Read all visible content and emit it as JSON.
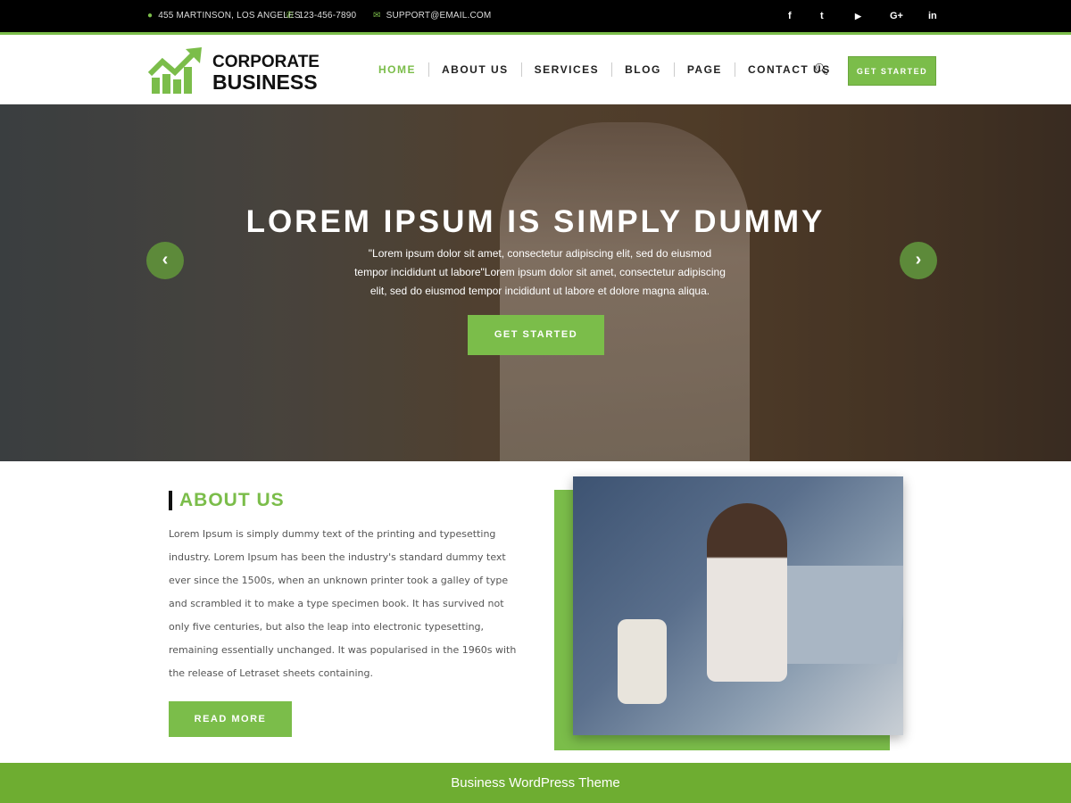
{
  "topbar": {
    "address": "455 MARTINSON, LOS ANGELES",
    "phone": "123-456-7890",
    "email": "SUPPORT@EMAIL.COM",
    "social": [
      {
        "icon": "facebook-icon",
        "glyph": "f"
      },
      {
        "icon": "twitter-icon",
        "glyph": "t"
      },
      {
        "icon": "youtube-icon",
        "glyph": "▶"
      },
      {
        "icon": "google-plus-icon",
        "glyph": "G+"
      },
      {
        "icon": "linkedin-icon",
        "glyph": "in"
      }
    ]
  },
  "header": {
    "logo_line1": "CORPORATE",
    "logo_line2": "BUSINESS",
    "nav": [
      "HOME",
      "ABOUT US",
      "SERVICES",
      "BLOG",
      "PAGE",
      "CONTACT US"
    ],
    "active": "HOME",
    "cta": "GET STARTED"
  },
  "hero": {
    "title": "LOREM IPSUM IS SIMPLY DUMMY",
    "text": "\"Lorem ipsum dolor sit amet, consectetur adipiscing elit, sed do eiusmod tempor incididunt ut labore\"Lorem ipsum dolor sit amet, consectetur adipiscing elit, sed do eiusmod tempor incididunt ut labore et dolore magna aliqua.",
    "cta": "GET STARTED"
  },
  "about": {
    "title": "ABOUT US",
    "text": "Lorem Ipsum is simply dummy text of the printing and typesetting industry. Lorem Ipsum has been the industry's standard dummy text ever since the 1500s, when an unknown printer took a galley of type and scrambled it to make a type specimen book. It has survived not only five centuries, but also the leap into electronic typesetting, remaining essentially unchanged. It was popularised in the 1960s with the release of Letraset sheets containing.",
    "cta": "READ MORE"
  },
  "footer": {
    "text": "Business WordPress Theme"
  },
  "colors": {
    "accent": "#7bbd4a",
    "footer": "#6ead31"
  }
}
